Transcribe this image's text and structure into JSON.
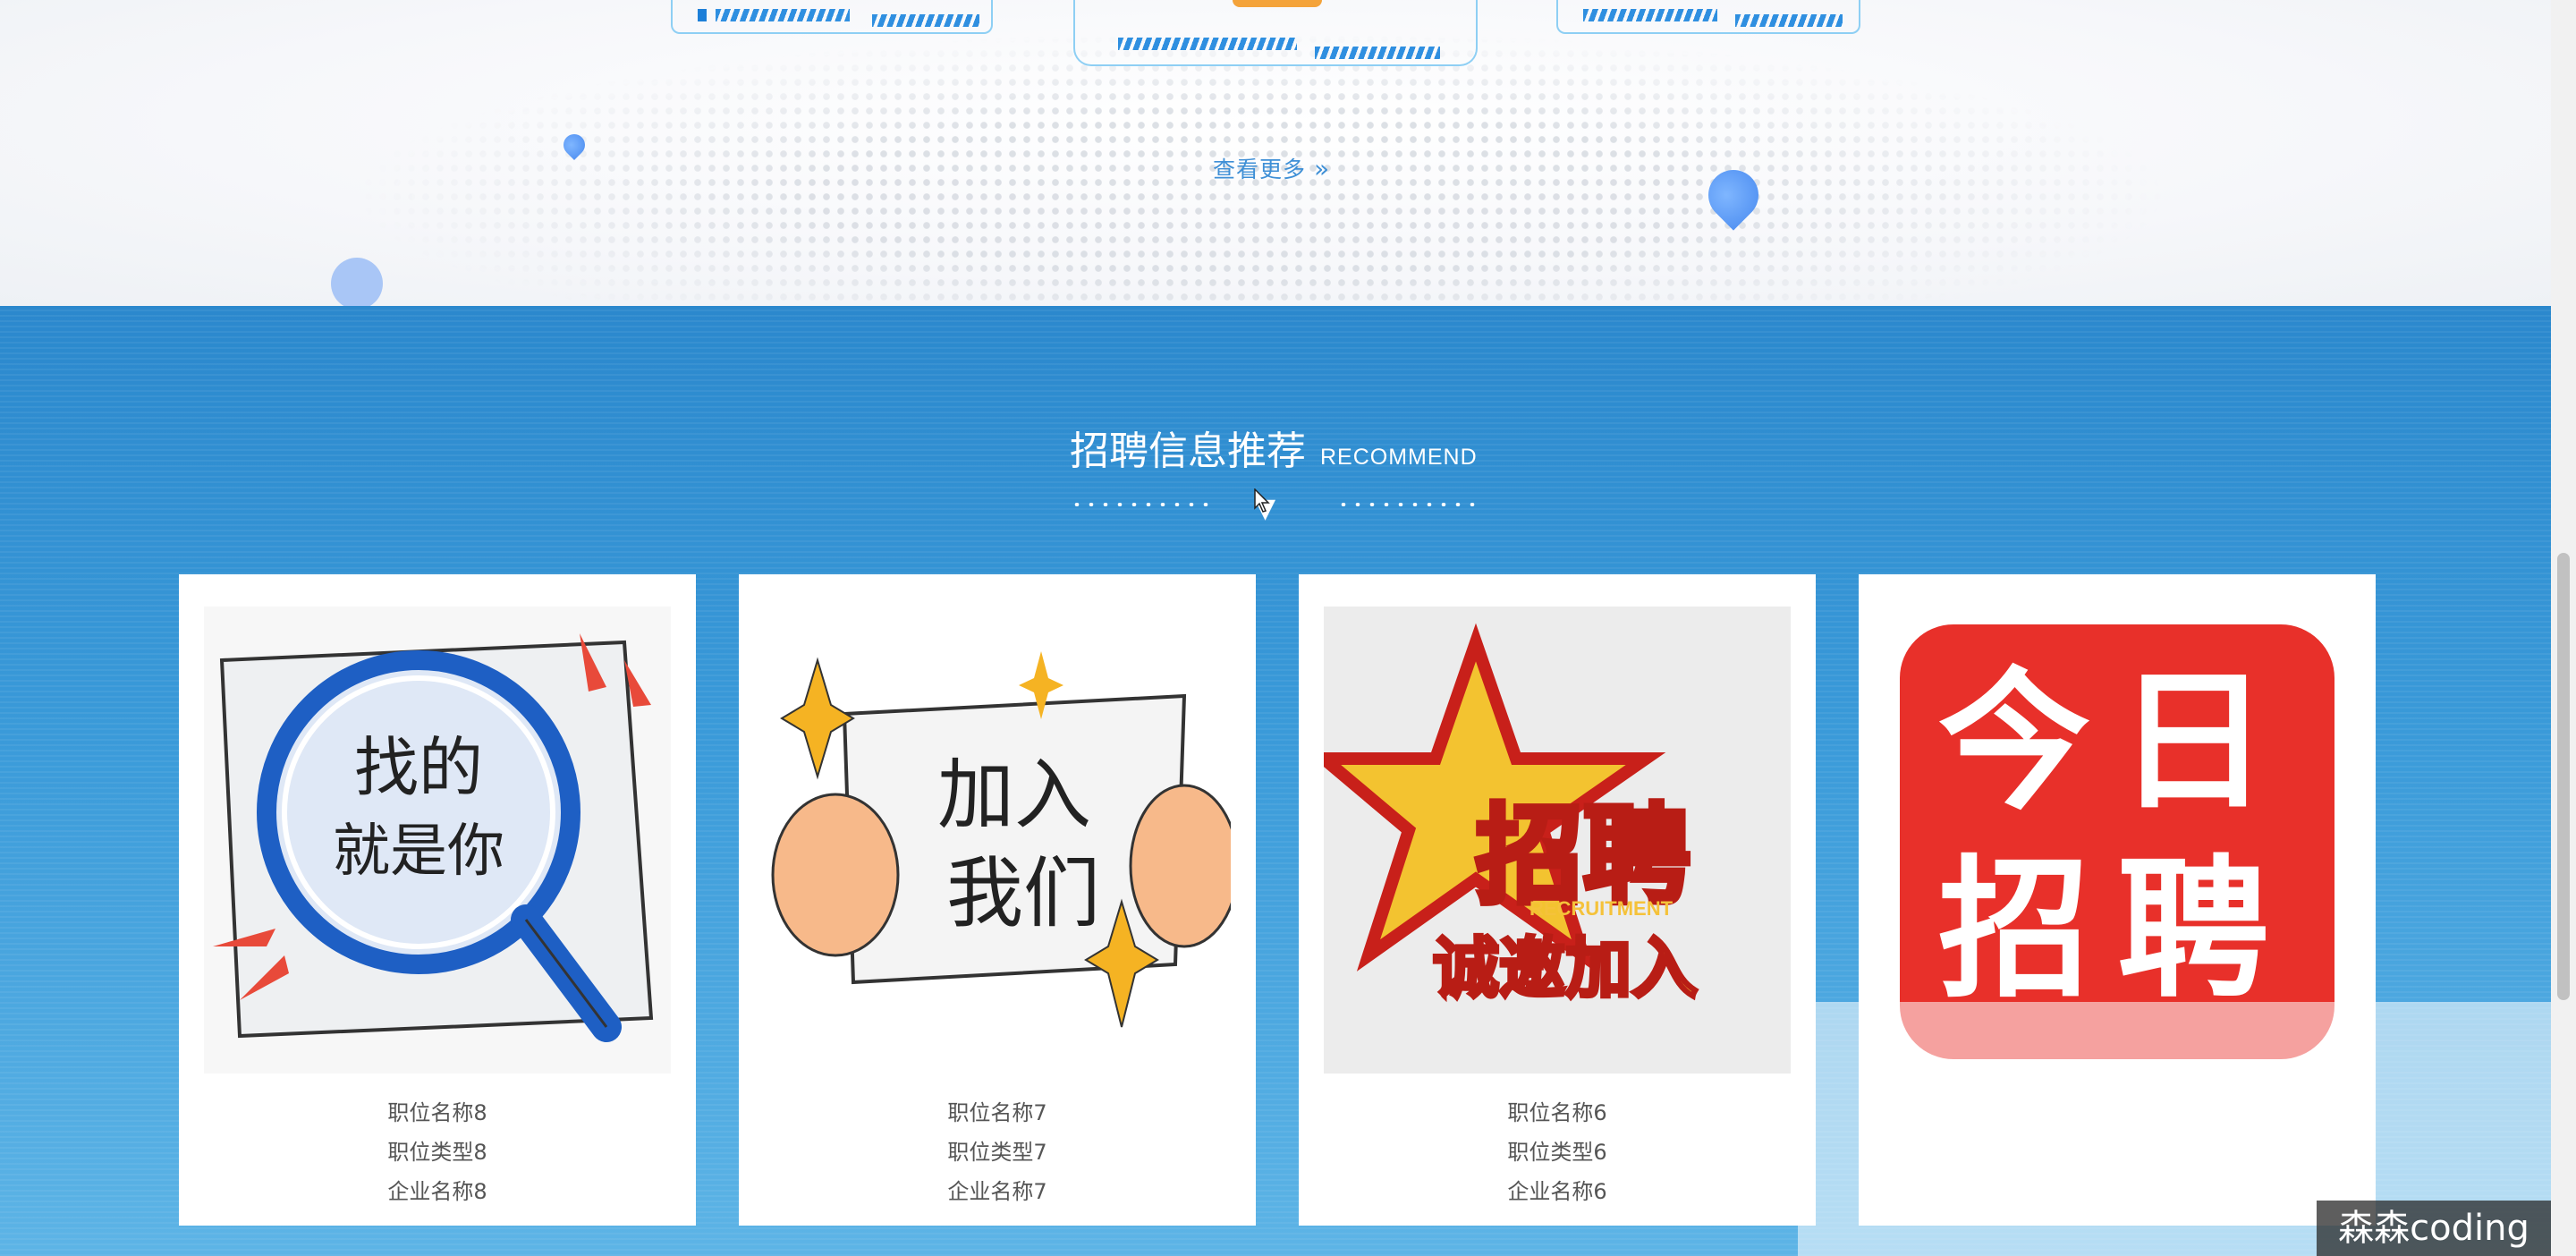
{
  "more_link": {
    "label": "查看更多",
    "icon": "double-chevron-right-icon"
  },
  "recommend": {
    "title": "招聘信息推荐",
    "subtitle": "RECOMMEND",
    "cards": [
      {
        "art_text": [
          "找的",
          "就是你"
        ],
        "position": "职位名称8",
        "type": "职位类型8",
        "company": "企业名称8"
      },
      {
        "art_text": [
          "加入",
          "我们"
        ],
        "position": "职位名称7",
        "type": "职位类型7",
        "company": "企业名称7"
      },
      {
        "art_text": [
          "招聘",
          "RECRUITMENT",
          "诚邀加入"
        ],
        "position": "职位名称6",
        "type": "职位类型6",
        "company": "企业名称6"
      },
      {
        "art_text": [
          "今日",
          "招聘"
        ],
        "position": "",
        "type": "",
        "company": ""
      }
    ]
  },
  "watermark": "森森coding",
  "colors": {
    "section_blue": "#2b88cd",
    "accent_red": "#e8302a",
    "link_blue": "#3e8fd6"
  }
}
